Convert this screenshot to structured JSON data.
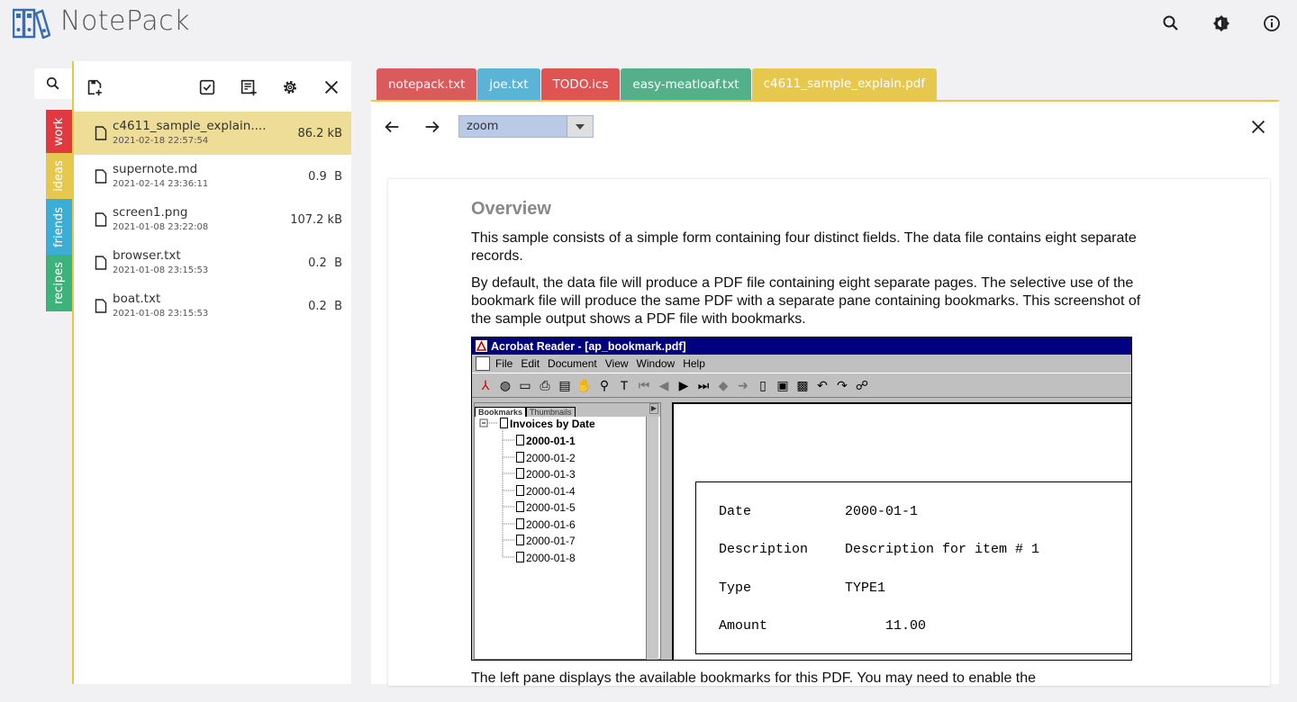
{
  "app": {
    "title": "NotePack"
  },
  "topbar": {
    "icons": [
      "search-icon",
      "brightness-icon",
      "info-icon"
    ]
  },
  "tags": [
    {
      "label": "work",
      "color": "#e2383f"
    },
    {
      "label": "ideas",
      "color": "#e5c84d"
    },
    {
      "label": "friends",
      "color": "#3baed6"
    },
    {
      "label": "recipes",
      "color": "#3cb37a"
    }
  ],
  "files": [
    {
      "name": "c4611_sample_explain....",
      "date": "2021-02-18 22:57:54",
      "size": "86.2 kB",
      "active": true
    },
    {
      "name": "supernote.md",
      "date": "2021-02-14 23:36:11",
      "size": "0.9  B",
      "active": false
    },
    {
      "name": "screen1.png",
      "date": "2021-01-08 23:22:08",
      "size": "107.2 kB",
      "active": false
    },
    {
      "name": "browser.txt",
      "date": "2021-01-08 23:15:53",
      "size": "0.2  B",
      "active": false
    },
    {
      "name": "boat.txt",
      "date": "2021-01-08 23:15:53",
      "size": "0.2  B",
      "active": false
    }
  ],
  "tabs": [
    {
      "label": "notepack.txt",
      "color": "#d95b5b"
    },
    {
      "label": "joe.txt",
      "color": "#5bb4d6"
    },
    {
      "label": "TODO.ics",
      "color": "#e05353"
    },
    {
      "label": "easy-meatloaf.txt",
      "color": "#54b08a"
    },
    {
      "label": "c4611_sample_explain.pdf",
      "color": "#e5c84d"
    }
  ],
  "viewer": {
    "zoom_value": "zoom"
  },
  "doc": {
    "heading": "Overview",
    "p1": "This sample consists of a simple form containing four distinct fields. The data file contains eight separate records.",
    "p2": "By default, the data file will produce a PDF file containing eight separate pages. The selective use of the bookmark file will produce the same PDF with a separate pane containing bookmarks. This screenshot of the sample output shows a PDF file with bookmarks.",
    "p3": "The left pane displays the available bookmarks for this PDF. You may need to enable the"
  },
  "acrobat": {
    "title": "Acrobat Reader - [ap_bookmark.pdf]",
    "menu": [
      "File",
      "Edit",
      "Document",
      "View",
      "Window",
      "Help"
    ],
    "left_tabs": [
      "Bookmarks",
      "Thumbnails"
    ],
    "bookmark_root": "Invoices by Date",
    "bookmarks": [
      "2000-01-1",
      "2000-01-2",
      "2000-01-3",
      "2000-01-4",
      "2000-01-5",
      "2000-01-6",
      "2000-01-7",
      "2000-01-8"
    ],
    "fields": [
      {
        "label": "Date",
        "value": "2000-01-1"
      },
      {
        "label": "Description",
        "value": "Description for item # 1"
      },
      {
        "label": "Type",
        "value": "TYPE1"
      },
      {
        "label": "Amount",
        "value": "     11.00"
      }
    ]
  }
}
